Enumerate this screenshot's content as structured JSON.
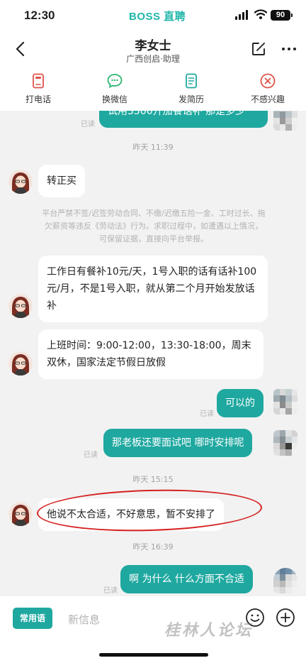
{
  "status_bar": {
    "time": "12:30",
    "app_name": "BOSS 直聘",
    "battery": "90"
  },
  "header": {
    "title": "李女士",
    "subtitle": "广西创启·助理"
  },
  "actions": [
    {
      "label": "打电话",
      "icon": "phone-card-icon"
    },
    {
      "label": "换微信",
      "icon": "wechat-bubble-icon"
    },
    {
      "label": "发简历",
      "icon": "resume-doc-icon"
    },
    {
      "label": "不感兴趣",
      "icon": "not-interested-icon"
    }
  ],
  "chat": {
    "partial_message": "试用3500开加餐话补 那是多少",
    "read_label": "已读",
    "timestamps": [
      "昨天 11:39",
      "昨天 15:15",
      "昨天 16:39"
    ],
    "notice": "平台严禁不签/迟签劳动合同、不缴/迟缴五险一金、工时过长、拖欠薪资等违反《劳动法》行为。求职过程中，如遭遇以上情况，可保留证据，直接向平台举报。",
    "messages": [
      {
        "side": "left",
        "text": "转正买"
      },
      {
        "side": "left",
        "text": "工作日有餐补10元/天，1号入职的话有话补100元/月，不是1号入职，就从第二个月开始发放话补"
      },
      {
        "side": "left",
        "text": "上班时间：9:00-12:00，13:30-18:00，周末双休，国家法定节假日放假"
      },
      {
        "side": "right",
        "text": "可以的",
        "status": "已读"
      },
      {
        "side": "right",
        "text": "那老板还要面试吧 哪时安排呢",
        "status": "已读"
      },
      {
        "side": "left",
        "text": "他说不太合适，不好意思，暂不安排了"
      },
      {
        "side": "right",
        "text": "啊 为什么 什么方面不合适",
        "status": "已读"
      }
    ]
  },
  "input_bar": {
    "quick_phrases": "常用语",
    "placeholder": "新信息",
    "watermark": "桂林人论坛"
  },
  "colors": {
    "accent": "#1fa8a0",
    "brand": "#1fb6a8",
    "highlight": "#d62020"
  }
}
